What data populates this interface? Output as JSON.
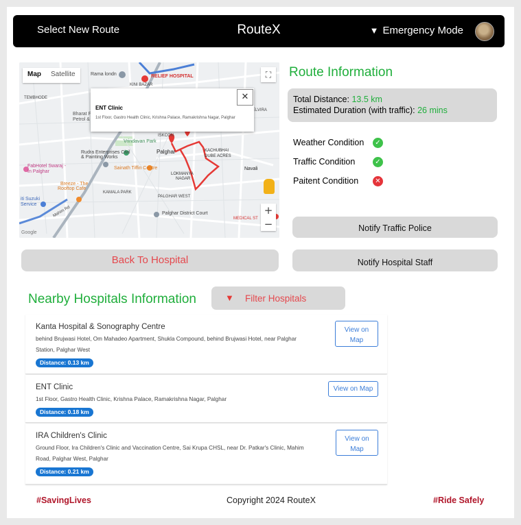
{
  "header": {
    "nav_label": "Select New Route",
    "brand": "RouteX",
    "emergency_label": "Emergency Mode",
    "emergency_icon": "triangle-down-icon"
  },
  "map": {
    "type_tabs": [
      "Map",
      "Satellite"
    ],
    "active_tab": "Map",
    "info_title": "ENT Clinic",
    "info_address": "1st Floor, Gastro Health Clinic, Krishna Palace, Ramakrishna Nagar, Palghar",
    "zoom_in": "+",
    "zoom_out": "−",
    "labels": {
      "relief": "RELIEF HOSPITAL",
      "rama": "Rama londn",
      "kini": "KINI BAZAR",
      "tembhode": "TEMBHODE",
      "bharat": "Bharat F",
      "petrol": "Petrol & Ch",
      "vrindavan": "Vrindavan Park",
      "rudra": "Rudra Enterprises Civil",
      "painting": "& Painting Works",
      "fabhotel": "FabHotel Swaraj -",
      "inpalghar": "In Palghar",
      "sainath": "Sainath Tiffin Centre",
      "breeze": "Breeze - The",
      "rooftop": "Rooftop Cafe",
      "kamala": "KAMALA PARK",
      "suzuki": "iti Suzuki",
      "service": "Service",
      "palghar": "Palghar",
      "lokmanya": "LOKMANYA",
      "nagar": "NAGAR",
      "palgharwest": "PALGHAR WEST",
      "kachubhai": "KACHUBHAI",
      "dubeacres": "DUBE ACRES",
      "navali": "Navali",
      "districtcourt": "Palghar District Court",
      "medical": "MEDICAL ST",
      "elvira": "ELVIRA",
      "iskcon": "ISKCON",
      "mahimrd": "Mahim Rd",
      "google": "Google"
    }
  },
  "route_info": {
    "title": "Route Information",
    "distance_label": "Total Distance: ",
    "distance_value": "13.5 km",
    "duration_label": "Estimated Duration (with traffic): ",
    "duration_value": "26 mins",
    "conditions": [
      {
        "label": "Weather Condition",
        "status": "ok"
      },
      {
        "label": "Traffic Condition",
        "status": "ok"
      },
      {
        "label": "Paitent Condition",
        "status": "bad"
      }
    ],
    "notify_police": "Notify Traffic Police",
    "notify_staff": "Notify Hospital Staff"
  },
  "back_button": "Back To Hospital",
  "nearby": {
    "title": "Nearby Hospitals Information",
    "filter_label": "Filter Hospitals",
    "hospitals": [
      {
        "name": "Kanta Hospital & Sonography Centre",
        "address_line1": "behind Brujwasi Hotel, Om Mahadeo Apartment, Shukla Compound, behind Brujwasi Hotel, near Palghar",
        "address_line2": "Station, Palghar West",
        "distance": "Distance: 0.13 km",
        "view_line1": "View on",
        "view_line2": "Map"
      },
      {
        "name": "ENT Clinic",
        "address_line1": "1st Floor, Gastro Health Clinic, Krishna Palace, Ramakrishna Nagar, Palghar",
        "address_line2": "",
        "distance": "Distance: 0.18 km",
        "view_line1": "View on Map",
        "view_line2": ""
      },
      {
        "name": "IRA Children's Clinic",
        "address_line1": "Ground Floor, Ira Children's Clinic and Vaccination Centre, Sai Krupa CHSL, near Dr. Patkar's Clinic, Mahim",
        "address_line2": "Road, Palghar West, Palghar",
        "distance": "Distance: 0.21 km",
        "view_line1": "View on",
        "view_line2": "Map"
      }
    ]
  },
  "footer": {
    "left": "#SavingLives",
    "center": "Copyright 2024 RouteX",
    "right": "#Ride Safely"
  },
  "colors": {
    "accent_green": "#1fae3b",
    "danger_red": "#e5484d",
    "link_blue": "#3b7dd8",
    "badge_blue": "#1976d2"
  }
}
